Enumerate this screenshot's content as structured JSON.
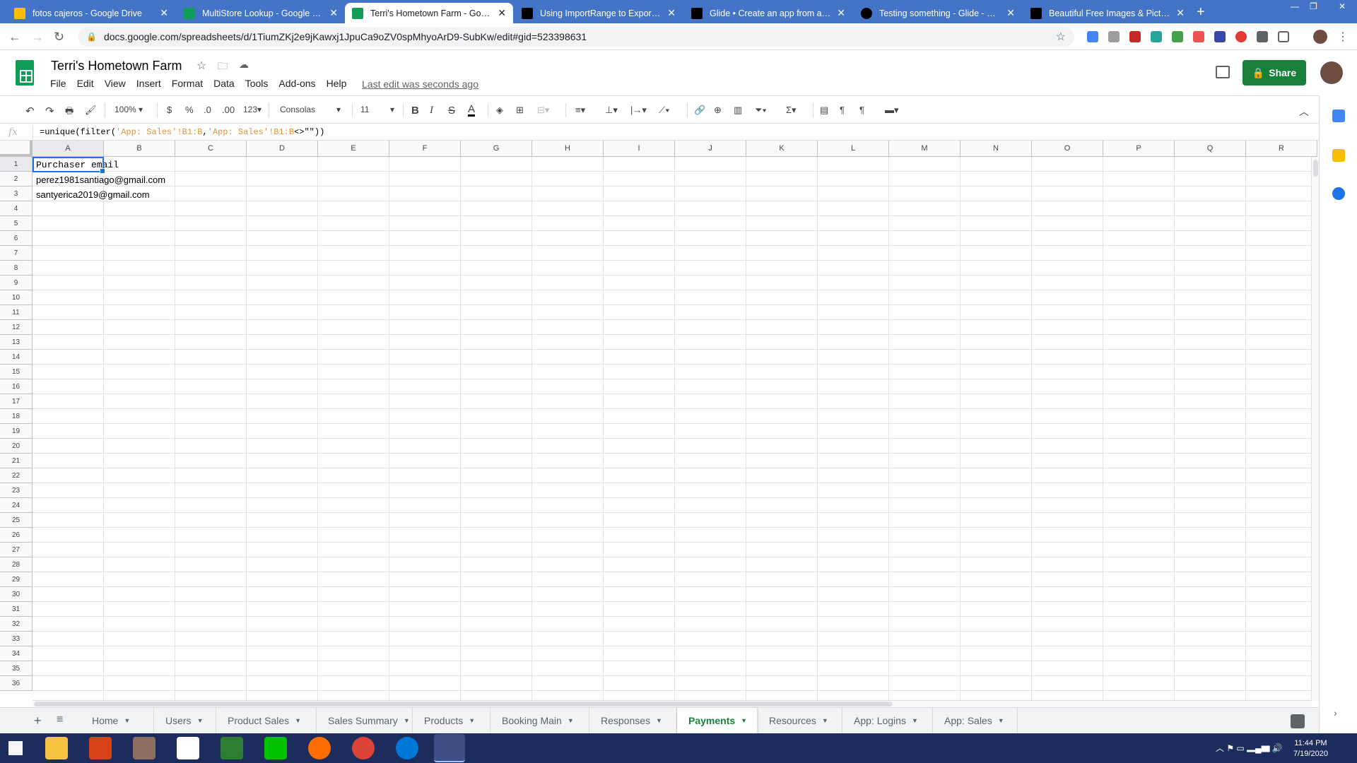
{
  "browser": {
    "tabs": [
      {
        "label": "fotos cajeros - Google Drive",
        "color": "#fbbc04"
      },
      {
        "label": "MultiStore Lookup - Google She",
        "color": "#0f9d58"
      },
      {
        "label": "Terri's Hometown Farm - Google",
        "color": "#0f9d58",
        "active": true
      },
      {
        "label": "Using ImportRange to Export Em",
        "color": "#000000"
      },
      {
        "label": "Glide • Create an app from a Go",
        "color": "#000000"
      },
      {
        "label": "Testing something - Glide - Creat",
        "color": "#000000"
      },
      {
        "label": "Beautiful Free Images & Pictures",
        "color": "#000000"
      }
    ],
    "url": "docs.google.com/spreadsheets/d/1TiumZKj2e9jKawxj1JpuCa9oZV0spMhyoArD9-SubKw/edit#gid=523398631"
  },
  "doc": {
    "title": "Terri's Hometown Farm",
    "menus": [
      "File",
      "Edit",
      "View",
      "Insert",
      "Format",
      "Data",
      "Tools",
      "Add-ons",
      "Help"
    ],
    "last_edit": "Last edit was seconds ago",
    "share_label": "Share"
  },
  "toolbar": {
    "zoom": "100%",
    "currency": "$",
    "percent": "%",
    "dec_less": ".0",
    "dec_more": ".00",
    "more_formats": "123",
    "font": "Consolas",
    "font_size": "11"
  },
  "formula": {
    "fx": "fx",
    "prefix": "=unique(filter(",
    "ref1": "'App: Sales'!B1:B",
    "comma": ",",
    "ref2": "'App: Sales'!B1:B",
    "suffix": "<>\"\"))"
  },
  "grid": {
    "columns": [
      "A",
      "B",
      "C",
      "D",
      "E",
      "F",
      "G",
      "H",
      "I",
      "J",
      "K",
      "L",
      "M",
      "N",
      "O",
      "P",
      "Q",
      "R"
    ],
    "rows": [
      "1",
      "2",
      "3",
      "4",
      "5",
      "6",
      "7",
      "8",
      "9",
      "10",
      "11",
      "12",
      "13",
      "14",
      "15",
      "16",
      "17",
      "18",
      "19",
      "20",
      "21",
      "22",
      "23",
      "24",
      "25",
      "26",
      "27",
      "28",
      "29",
      "30",
      "31",
      "32",
      "33",
      "34",
      "35",
      "36"
    ],
    "cells": {
      "a1": "Purchaser email",
      "a2": "perez1981santiago@gmail.com",
      "a3": "santyerica2019@gmail.com"
    }
  },
  "sheets": [
    "Home",
    "Users",
    "Product Sales",
    "Sales Summary",
    "Products",
    "Booking Main",
    "Responses",
    "Payments",
    "Resources",
    "App: Logins",
    "App: Sales"
  ],
  "active_sheet": "Payments",
  "taskbar": {
    "time": "11:44 PM",
    "date": "7/19/2020"
  }
}
